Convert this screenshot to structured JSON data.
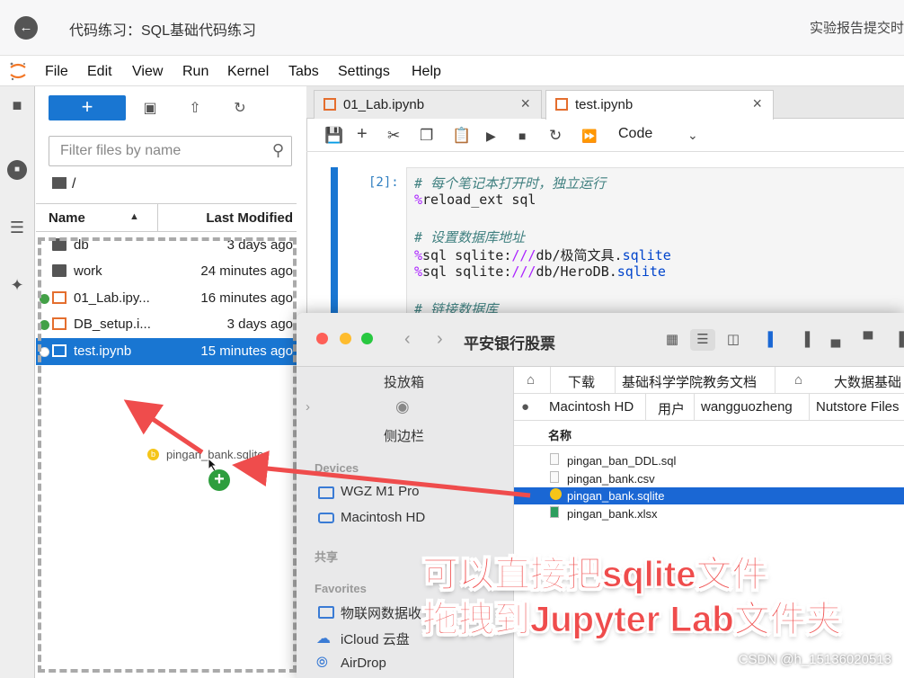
{
  "topbar": {
    "title": "代码练习：SQL基础代码练习",
    "report": "实验报告提交时"
  },
  "menu": [
    "File",
    "Edit",
    "View",
    "Run",
    "Kernel",
    "Tabs",
    "Settings",
    "Help"
  ],
  "filebrowser": {
    "new_label": "+",
    "filter_placeholder": "Filter files by name",
    "breadcrumb": "/",
    "col_name": "Name",
    "col_modified": "Last Modified",
    "files": [
      {
        "name": "db",
        "modified": "3 days ago",
        "type": "folder",
        "running": false,
        "selected": false
      },
      {
        "name": "work",
        "modified": "24 minutes ago",
        "type": "folder",
        "running": false,
        "selected": false
      },
      {
        "name": "01_Lab.ipy...",
        "modified": "16 minutes ago",
        "type": "notebook",
        "running": true,
        "selected": false
      },
      {
        "name": "DB_setup.i...",
        "modified": "3 days ago",
        "type": "notebook",
        "running": true,
        "selected": false
      },
      {
        "name": "test.ipynb",
        "modified": "15 minutes ago",
        "type": "notebook",
        "running": true,
        "selected": true
      }
    ],
    "drag_file": "pingan_bank.sqlite"
  },
  "tabs": [
    {
      "label": "01_Lab.ipynb",
      "active": false
    },
    {
      "label": "test.ipynb",
      "active": true
    }
  ],
  "notebook": {
    "cell_type": "Code",
    "prompt": "[2]:",
    "code": [
      {
        "c": "# 每个笔记本打开时，独立运行"
      },
      {
        "m": "%",
        "t": "reload_ext sql"
      },
      {
        "t": ""
      },
      {
        "c": "# 设置数据库地址"
      },
      {
        "m": "%",
        "t": "sql sqlite:",
        "k": "///",
        "t2": "db/极简文具.",
        "k2": "sqlite"
      },
      {
        "m": "%",
        "t": "sql sqlite:",
        "k": "///",
        "t2": "db/HeroDB.",
        "k2": "sqlite"
      },
      {
        "t": ""
      },
      {
        "c": "# 链接数据库"
      }
    ]
  },
  "finder": {
    "title": "平安银行股票",
    "sidebar": {
      "top_items": [
        "投放箱",
        "侧边栏"
      ],
      "devices_header": "Devices",
      "devices": [
        "WGZ M1 Pro",
        "Macintosh HD"
      ],
      "shared_header": "共享",
      "favorites_header": "Favorites",
      "favorites": [
        "物联网数据收",
        "iCloud 云盘",
        "AirDrop"
      ]
    },
    "path1": [
      "下载",
      "基础科学学院教务文档",
      "大数据基础"
    ],
    "path2": [
      "Macintosh HD",
      "用户",
      "wangguozheng",
      "Nutstore Files"
    ],
    "col_name": "名称",
    "files": [
      {
        "name": "pingan_ban_DDL.sql",
        "selected": false
      },
      {
        "name": "pingan_bank.csv",
        "selected": false
      },
      {
        "name": "pingan_bank.sqlite",
        "selected": true
      },
      {
        "name": "pingan_bank.xlsx",
        "selected": false
      }
    ]
  },
  "annotation": {
    "line1": "可以直接把sqlite文件",
    "line2": "拖拽到Jupyter Lab文件夹"
  },
  "watermark": "CSDN @h_15136020513",
  "colors": {
    "accent": "#1976d2",
    "annotation": "#ef4c4c",
    "notebook_icon": "#e46e2e"
  }
}
